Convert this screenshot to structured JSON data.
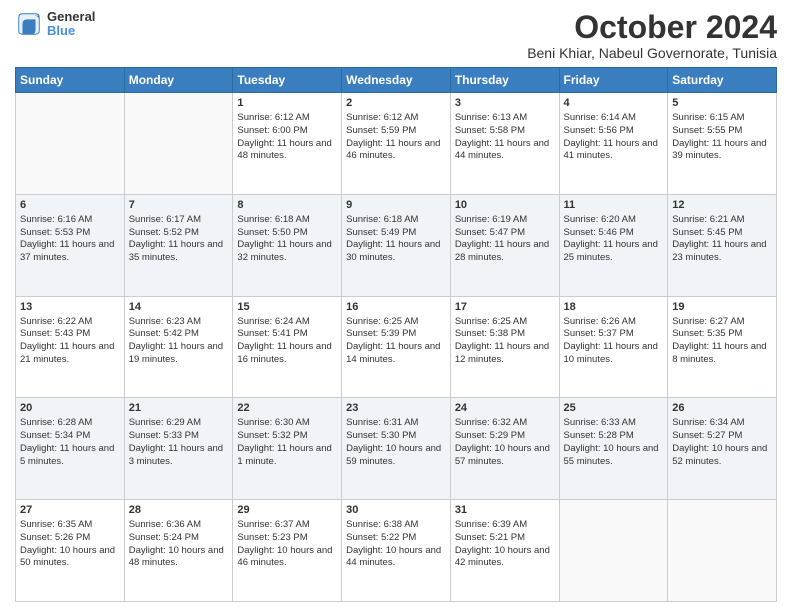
{
  "logo": {
    "line1": "General",
    "line2": "Blue"
  },
  "title": "October 2024",
  "location": "Beni Khiar, Nabeul Governorate, Tunisia",
  "days_of_week": [
    "Sunday",
    "Monday",
    "Tuesday",
    "Wednesday",
    "Thursday",
    "Friday",
    "Saturday"
  ],
  "weeks": [
    [
      {
        "day": "",
        "sunrise": "",
        "sunset": "",
        "daylight": ""
      },
      {
        "day": "",
        "sunrise": "",
        "sunset": "",
        "daylight": ""
      },
      {
        "day": "1",
        "sunrise": "Sunrise: 6:12 AM",
        "sunset": "Sunset: 6:00 PM",
        "daylight": "Daylight: 11 hours and 48 minutes."
      },
      {
        "day": "2",
        "sunrise": "Sunrise: 6:12 AM",
        "sunset": "Sunset: 5:59 PM",
        "daylight": "Daylight: 11 hours and 46 minutes."
      },
      {
        "day": "3",
        "sunrise": "Sunrise: 6:13 AM",
        "sunset": "Sunset: 5:58 PM",
        "daylight": "Daylight: 11 hours and 44 minutes."
      },
      {
        "day": "4",
        "sunrise": "Sunrise: 6:14 AM",
        "sunset": "Sunset: 5:56 PM",
        "daylight": "Daylight: 11 hours and 41 minutes."
      },
      {
        "day": "5",
        "sunrise": "Sunrise: 6:15 AM",
        "sunset": "Sunset: 5:55 PM",
        "daylight": "Daylight: 11 hours and 39 minutes."
      }
    ],
    [
      {
        "day": "6",
        "sunrise": "Sunrise: 6:16 AM",
        "sunset": "Sunset: 5:53 PM",
        "daylight": "Daylight: 11 hours and 37 minutes."
      },
      {
        "day": "7",
        "sunrise": "Sunrise: 6:17 AM",
        "sunset": "Sunset: 5:52 PM",
        "daylight": "Daylight: 11 hours and 35 minutes."
      },
      {
        "day": "8",
        "sunrise": "Sunrise: 6:18 AM",
        "sunset": "Sunset: 5:50 PM",
        "daylight": "Daylight: 11 hours and 32 minutes."
      },
      {
        "day": "9",
        "sunrise": "Sunrise: 6:18 AM",
        "sunset": "Sunset: 5:49 PM",
        "daylight": "Daylight: 11 hours and 30 minutes."
      },
      {
        "day": "10",
        "sunrise": "Sunrise: 6:19 AM",
        "sunset": "Sunset: 5:47 PM",
        "daylight": "Daylight: 11 hours and 28 minutes."
      },
      {
        "day": "11",
        "sunrise": "Sunrise: 6:20 AM",
        "sunset": "Sunset: 5:46 PM",
        "daylight": "Daylight: 11 hours and 25 minutes."
      },
      {
        "day": "12",
        "sunrise": "Sunrise: 6:21 AM",
        "sunset": "Sunset: 5:45 PM",
        "daylight": "Daylight: 11 hours and 23 minutes."
      }
    ],
    [
      {
        "day": "13",
        "sunrise": "Sunrise: 6:22 AM",
        "sunset": "Sunset: 5:43 PM",
        "daylight": "Daylight: 11 hours and 21 minutes."
      },
      {
        "day": "14",
        "sunrise": "Sunrise: 6:23 AM",
        "sunset": "Sunset: 5:42 PM",
        "daylight": "Daylight: 11 hours and 19 minutes."
      },
      {
        "day": "15",
        "sunrise": "Sunrise: 6:24 AM",
        "sunset": "Sunset: 5:41 PM",
        "daylight": "Daylight: 11 hours and 16 minutes."
      },
      {
        "day": "16",
        "sunrise": "Sunrise: 6:25 AM",
        "sunset": "Sunset: 5:39 PM",
        "daylight": "Daylight: 11 hours and 14 minutes."
      },
      {
        "day": "17",
        "sunrise": "Sunrise: 6:25 AM",
        "sunset": "Sunset: 5:38 PM",
        "daylight": "Daylight: 11 hours and 12 minutes."
      },
      {
        "day": "18",
        "sunrise": "Sunrise: 6:26 AM",
        "sunset": "Sunset: 5:37 PM",
        "daylight": "Daylight: 11 hours and 10 minutes."
      },
      {
        "day": "19",
        "sunrise": "Sunrise: 6:27 AM",
        "sunset": "Sunset: 5:35 PM",
        "daylight": "Daylight: 11 hours and 8 minutes."
      }
    ],
    [
      {
        "day": "20",
        "sunrise": "Sunrise: 6:28 AM",
        "sunset": "Sunset: 5:34 PM",
        "daylight": "Daylight: 11 hours and 5 minutes."
      },
      {
        "day": "21",
        "sunrise": "Sunrise: 6:29 AM",
        "sunset": "Sunset: 5:33 PM",
        "daylight": "Daylight: 11 hours and 3 minutes."
      },
      {
        "day": "22",
        "sunrise": "Sunrise: 6:30 AM",
        "sunset": "Sunset: 5:32 PM",
        "daylight": "Daylight: 11 hours and 1 minute."
      },
      {
        "day": "23",
        "sunrise": "Sunrise: 6:31 AM",
        "sunset": "Sunset: 5:30 PM",
        "daylight": "Daylight: 10 hours and 59 minutes."
      },
      {
        "day": "24",
        "sunrise": "Sunrise: 6:32 AM",
        "sunset": "Sunset: 5:29 PM",
        "daylight": "Daylight: 10 hours and 57 minutes."
      },
      {
        "day": "25",
        "sunrise": "Sunrise: 6:33 AM",
        "sunset": "Sunset: 5:28 PM",
        "daylight": "Daylight: 10 hours and 55 minutes."
      },
      {
        "day": "26",
        "sunrise": "Sunrise: 6:34 AM",
        "sunset": "Sunset: 5:27 PM",
        "daylight": "Daylight: 10 hours and 52 minutes."
      }
    ],
    [
      {
        "day": "27",
        "sunrise": "Sunrise: 6:35 AM",
        "sunset": "Sunset: 5:26 PM",
        "daylight": "Daylight: 10 hours and 50 minutes."
      },
      {
        "day": "28",
        "sunrise": "Sunrise: 6:36 AM",
        "sunset": "Sunset: 5:24 PM",
        "daylight": "Daylight: 10 hours and 48 minutes."
      },
      {
        "day": "29",
        "sunrise": "Sunrise: 6:37 AM",
        "sunset": "Sunset: 5:23 PM",
        "daylight": "Daylight: 10 hours and 46 minutes."
      },
      {
        "day": "30",
        "sunrise": "Sunrise: 6:38 AM",
        "sunset": "Sunset: 5:22 PM",
        "daylight": "Daylight: 10 hours and 44 minutes."
      },
      {
        "day": "31",
        "sunrise": "Sunrise: 6:39 AM",
        "sunset": "Sunset: 5:21 PM",
        "daylight": "Daylight: 10 hours and 42 minutes."
      },
      {
        "day": "",
        "sunrise": "",
        "sunset": "",
        "daylight": ""
      },
      {
        "day": "",
        "sunrise": "",
        "sunset": "",
        "daylight": ""
      }
    ]
  ]
}
